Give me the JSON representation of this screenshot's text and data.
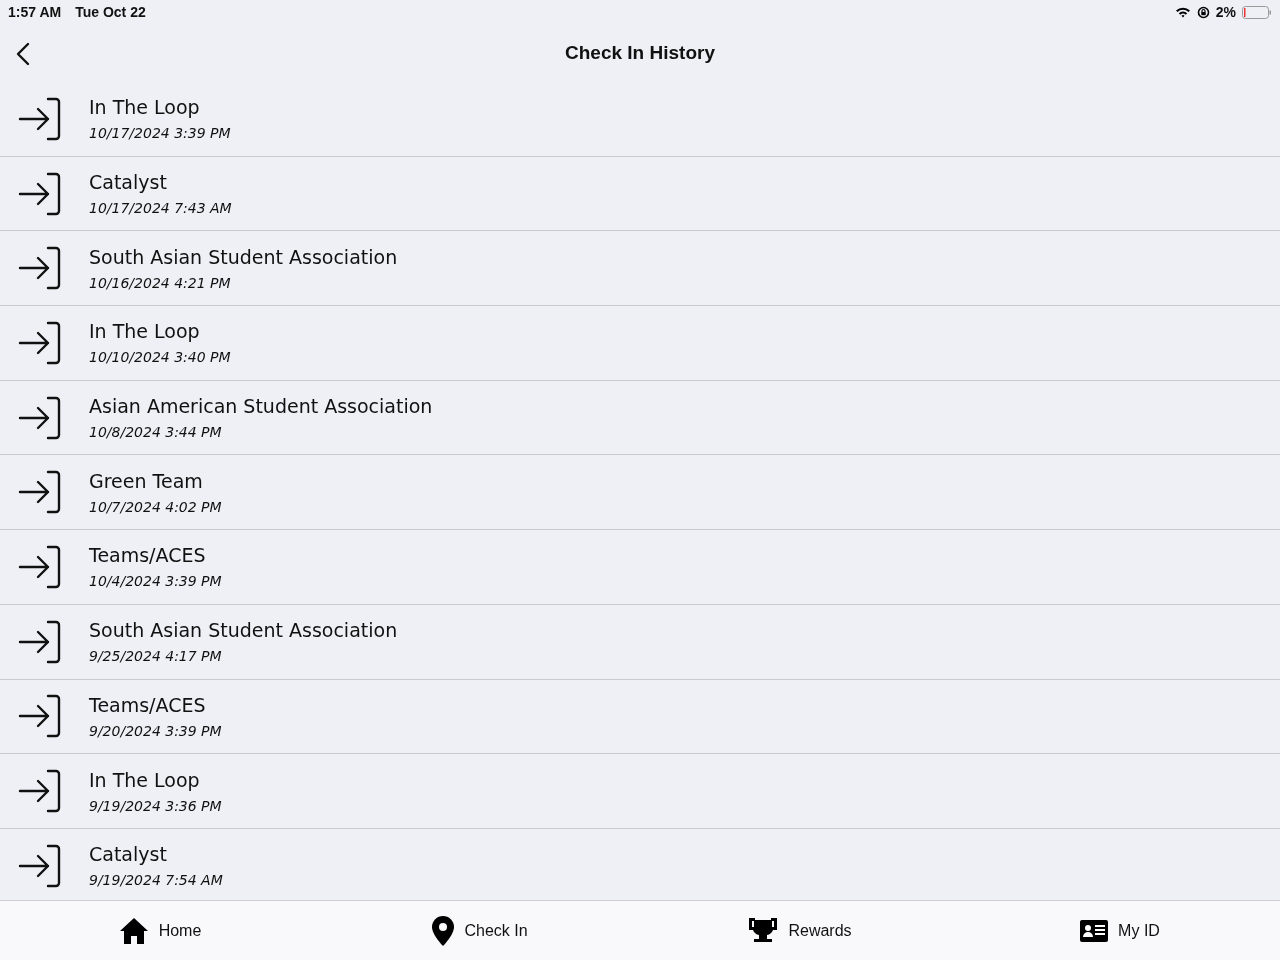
{
  "status_bar": {
    "time": "1:57 AM",
    "date": "Tue Oct 22",
    "battery": "2%"
  },
  "header": {
    "title": "Check In History"
  },
  "check_ins": [
    {
      "name": "In The Loop",
      "datetime": "10/17/2024 3:39 PM"
    },
    {
      "name": "Catalyst",
      "datetime": "10/17/2024 7:43 AM"
    },
    {
      "name": "South Asian Student Association",
      "datetime": "10/16/2024 4:21 PM"
    },
    {
      "name": "In The Loop",
      "datetime": "10/10/2024 3:40 PM"
    },
    {
      "name": "Asian American Student Association",
      "datetime": "10/8/2024 3:44 PM"
    },
    {
      "name": "Green Team",
      "datetime": "10/7/2024 4:02 PM"
    },
    {
      "name": "Teams/ACES",
      "datetime": "10/4/2024 3:39 PM"
    },
    {
      "name": "South Asian Student Association",
      "datetime": "9/25/2024 4:17 PM"
    },
    {
      "name": "Teams/ACES",
      "datetime": "9/20/2024 3:39 PM"
    },
    {
      "name": "In The Loop",
      "datetime": "9/19/2024 3:36 PM"
    },
    {
      "name": "Catalyst",
      "datetime": "9/19/2024 7:54 AM"
    }
  ],
  "tab_bar": [
    {
      "label": "Home",
      "kind": "home"
    },
    {
      "label": "Check In",
      "kind": "pin"
    },
    {
      "label": "Rewards",
      "kind": "trophy"
    },
    {
      "label": "My ID",
      "kind": "id"
    }
  ]
}
